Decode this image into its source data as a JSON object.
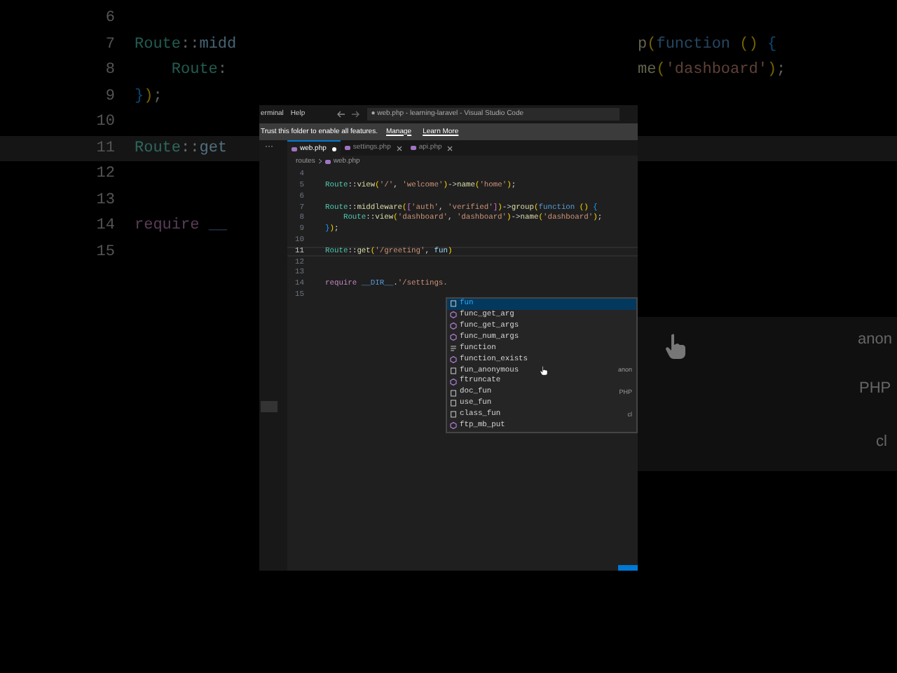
{
  "background_code": {
    "lines": [
      {
        "number": "6"
      },
      {
        "number": "7",
        "left": "Route::midd",
        "right": "p(function () {"
      },
      {
        "number": "8",
        "left": "    Route:",
        "right": "me('dashboard');"
      },
      {
        "number": "9",
        "left": "});"
      },
      {
        "number": "10"
      },
      {
        "number": "11",
        "left": "Route::get",
        "current": true
      },
      {
        "number": "12"
      },
      {
        "number": "13"
      },
      {
        "number": "14",
        "left": "require __"
      },
      {
        "number": "15"
      }
    ],
    "suggest_details": [
      "anon",
      "PHP",
      "cl"
    ]
  },
  "window": {
    "more": "···",
    "menu": [
      "erminal",
      "Help"
    ],
    "title": "● web.php - learning-laravel - Visual Studio Code"
  },
  "trust_banner": {
    "message": "Trust this folder to enable all features.",
    "links": [
      "Manage",
      "Learn More"
    ]
  },
  "tabs": [
    {
      "label": "web.php",
      "selected": true,
      "modified": true
    },
    {
      "label": "settings.php",
      "selected": false,
      "modified": false
    },
    {
      "label": "api.php",
      "selected": false,
      "modified": false
    }
  ],
  "breadcrumb": [
    "routes",
    "web.php"
  ],
  "editor": {
    "lines": [
      {
        "number": "4"
      },
      {
        "number": "5",
        "code": "Route::view('/', 'welcome')->name('home');"
      },
      {
        "number": "6"
      },
      {
        "number": "7",
        "code": "Route::middleware(['auth', 'verified'])->group(function () {"
      },
      {
        "number": "8",
        "code": "    Route::view('dashboard', 'dashboard')->name('dashboard');"
      },
      {
        "number": "9",
        "code": "});"
      },
      {
        "number": "10"
      },
      {
        "number": "11",
        "code": "Route::get('/greeting', fun)",
        "current": true
      },
      {
        "number": "12"
      },
      {
        "number": "13"
      },
      {
        "number": "14",
        "code": "require __DIR__.'/settings."
      },
      {
        "number": "15"
      }
    ]
  },
  "suggest": {
    "items": [
      {
        "label": "fun",
        "kind": "keyword",
        "selected": true
      },
      {
        "label": "func_get_arg",
        "kind": "method",
        "selected": false
      },
      {
        "label": "func_get_args",
        "kind": "method",
        "selected": false
      },
      {
        "label": "func_num_args",
        "kind": "method",
        "selected": false
      },
      {
        "label": "function",
        "kind": "snippet",
        "selected": false
      },
      {
        "label": "function_exists",
        "kind": "method",
        "selected": false
      },
      {
        "label": "fun_anonymous",
        "kind": "keyword",
        "selected": false,
        "detail": "anon"
      },
      {
        "label": "ftruncate",
        "kind": "method",
        "selected": false
      },
      {
        "label": "doc_fun",
        "kind": "keyword",
        "selected": false,
        "detail": "PHP"
      },
      {
        "label": "use_fun",
        "kind": "keyword",
        "selected": false
      },
      {
        "label": "class_fun",
        "kind": "keyword",
        "selected": false,
        "detail": "cl"
      },
      {
        "label": "ftp_mb_put",
        "kind": "method",
        "selected": false
      }
    ]
  }
}
